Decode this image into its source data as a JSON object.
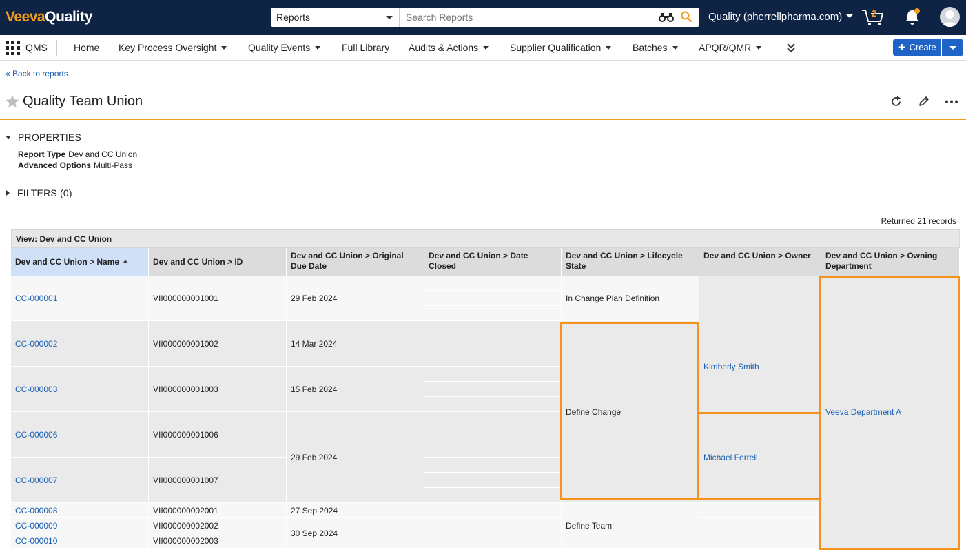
{
  "app": {
    "logo_brand": "Veeva",
    "logo_product": "Quality",
    "vault_name": "Quality (pherrellpharma.com)",
    "cart_count": "2",
    "accent": "#f39c1b",
    "link_color": "#1a5fb4",
    "highlight": "#f5921e"
  },
  "search": {
    "scope": "Reports",
    "placeholder": "Search Reports"
  },
  "nav": {
    "app_name": "QMS",
    "items": [
      {
        "label": "Home",
        "dropdown": false
      },
      {
        "label": "Key Process Oversight",
        "dropdown": true
      },
      {
        "label": "Quality Events",
        "dropdown": true
      },
      {
        "label": "Full Library",
        "dropdown": false
      },
      {
        "label": "Audits & Actions",
        "dropdown": true
      },
      {
        "label": "Supplier Qualification",
        "dropdown": true
      },
      {
        "label": "Batches",
        "dropdown": true
      },
      {
        "label": "APQR/QMR",
        "dropdown": true
      }
    ],
    "create_label": "Create"
  },
  "page": {
    "back_link": "« Back to reports",
    "title": "Quality Team Union",
    "properties_label": "PROPERTIES",
    "props": [
      {
        "key": "Report Type",
        "value": "Dev and CC Union"
      },
      {
        "key": "Advanced Options",
        "value": "Multi-Pass"
      }
    ],
    "filters_label": "FILTERS (0)",
    "returned": "Returned 21 records"
  },
  "report": {
    "view_label": "View: Dev and CC Union",
    "columns": [
      "Dev and CC Union > Name",
      "Dev and CC Union > ID",
      "Dev and CC Union > Original Due Date",
      "Dev and CC Union > Date Closed",
      "Dev and CC Union > Lifecycle State",
      "Dev and CC Union > Owner",
      "Dev and CC Union > Owning Department"
    ],
    "rows": [
      {
        "name": "CC-000001",
        "id": "VII000000001001"
      },
      {
        "name": "CC-000002",
        "id": "VII000000001002"
      },
      {
        "name": "CC-000003",
        "id": "VII000000001003"
      },
      {
        "name": "CC-000006",
        "id": "VII000000001006"
      },
      {
        "name": "CC-000007",
        "id": "VII000000001007"
      },
      {
        "name": "CC-000008",
        "id": "VII000000002001"
      },
      {
        "name": "CC-000009",
        "id": "VII000000002002"
      },
      {
        "name": "CC-000010",
        "id": "VII000000002003"
      }
    ],
    "due_dates": [
      "29 Feb 2024",
      "14 Mar 2024",
      "15 Feb 2024",
      "29 Feb 2024",
      "27 Sep 2024",
      "30 Sep 2024"
    ],
    "states": [
      "In Change Plan Definition",
      "Define Change",
      "Define Team"
    ],
    "owners": [
      "Kimberly Smith",
      "Michael Ferrell"
    ],
    "department": "Veeva Department A"
  }
}
